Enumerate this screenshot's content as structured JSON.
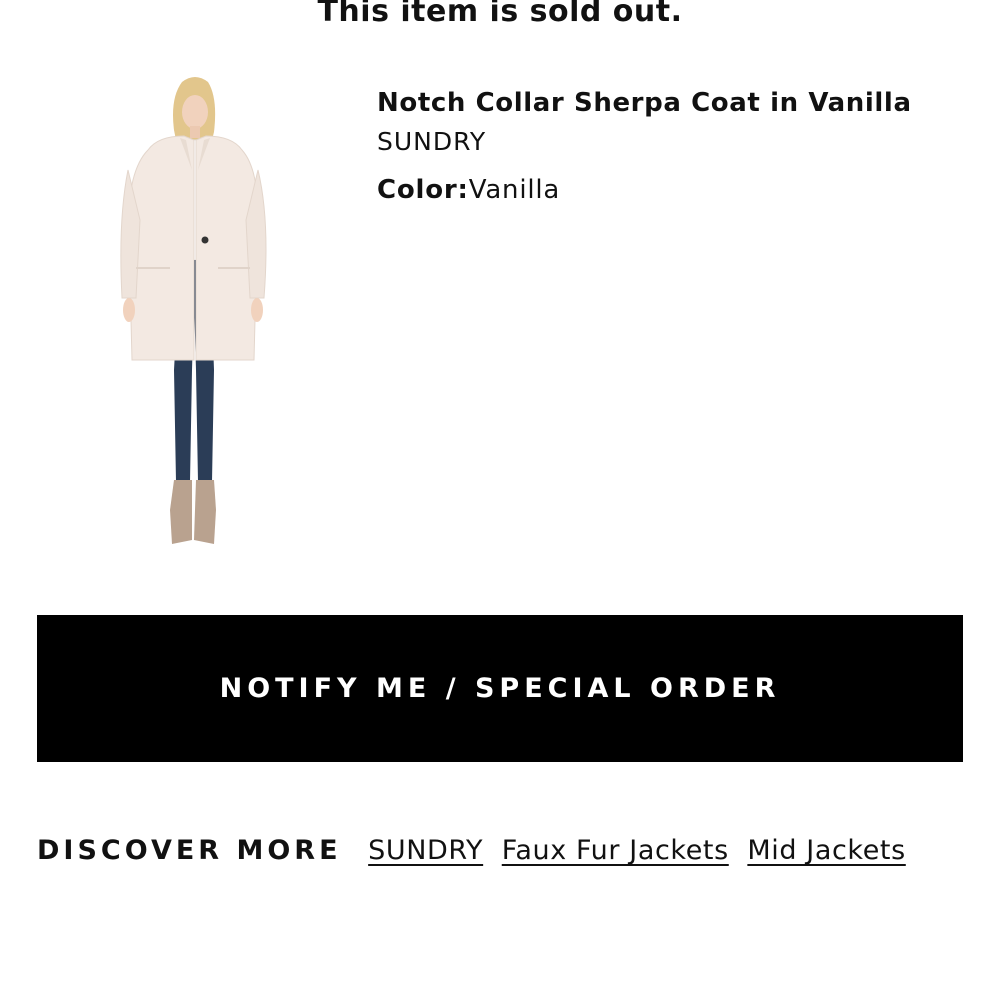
{
  "banner": {
    "sold_out_text": "This item is sold out."
  },
  "product": {
    "image_alt": "Model wearing Notch Collar Sherpa Coat in Vanilla",
    "title": "Notch Collar Sherpa Coat in Vanilla",
    "brand": "SUNDRY",
    "color_label": "Color:",
    "color_value": "Vanilla"
  },
  "actions": {
    "notify_label": "NOTIFY ME / SPECIAL ORDER"
  },
  "discover": {
    "label": "DISCOVER MORE",
    "links": [
      "SUNDRY",
      "Faux Fur Jackets",
      "Mid Jackets"
    ]
  },
  "colors": {
    "button_bg": "#000000",
    "button_text": "#ffffff",
    "coat": "#f3e9e2",
    "jeans": "#2b3d57",
    "boots": "#b9a28f"
  }
}
